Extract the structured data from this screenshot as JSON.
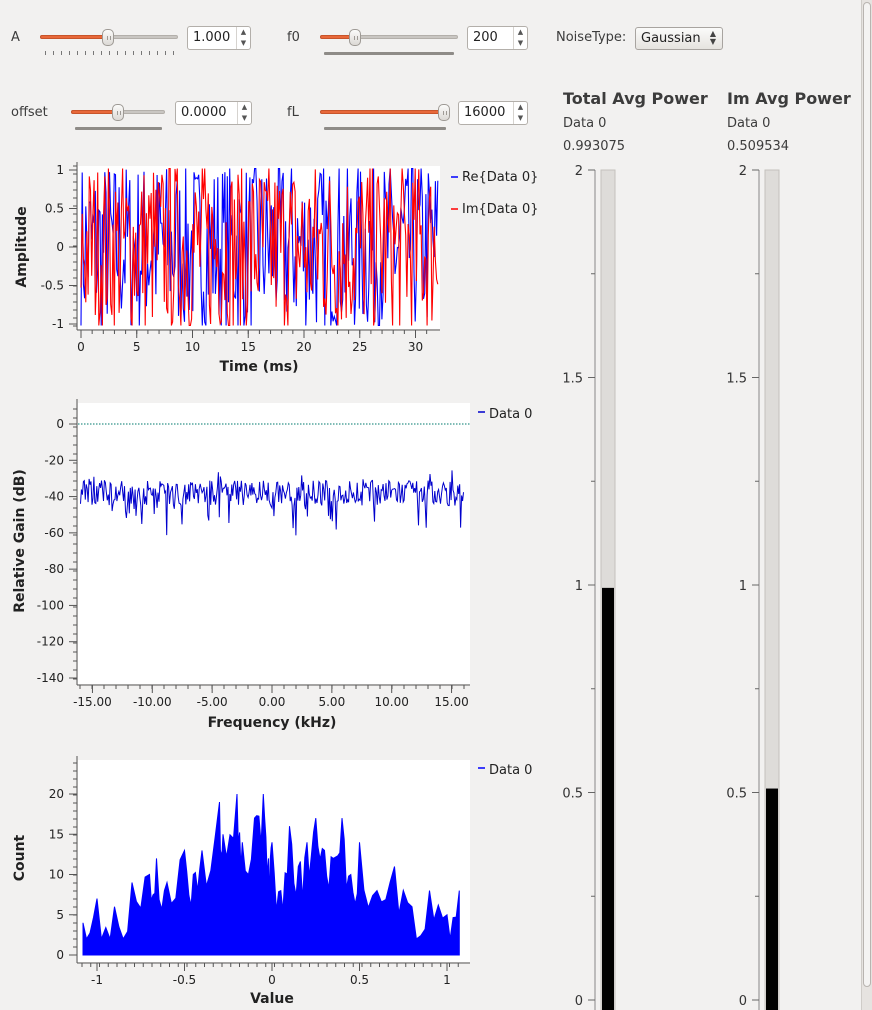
{
  "controls": {
    "a": {
      "label": "A",
      "value": "1.000",
      "fraction": 0.49
    },
    "f0": {
      "label": "f0",
      "value": "200",
      "fraction": 0.23
    },
    "noise_type": {
      "label": "NoiseType:",
      "value": "Gaussian"
    },
    "offset": {
      "label": "offset",
      "value": "0.0000",
      "fraction": 0.5
    },
    "fl": {
      "label": "fL",
      "value": "16000",
      "fraction": 1.0
    }
  },
  "time_plot": {
    "ylabel": "Amplitude",
    "xlabel": "Time (ms)",
    "yticks": [
      "1",
      "0.5",
      "0",
      "-0.5",
      "-1"
    ],
    "xticks": [
      "0",
      "5",
      "10",
      "15",
      "20",
      "25",
      "30"
    ],
    "legend": [
      "Re{Data 0}",
      "Im{Data 0}"
    ],
    "colors": [
      "#0000ff",
      "#ff0000"
    ]
  },
  "freq_plot": {
    "ylabel": "Relative Gain (dB)",
    "xlabel": "Frequency (kHz)",
    "yticks": [
      "0",
      "-20",
      "-40",
      "-60",
      "-80",
      "-100",
      "-120",
      "-140"
    ],
    "xticks": [
      "-15.00",
      "-10.00",
      "-5.00",
      "0.00",
      "5.00",
      "10.00",
      "15.00"
    ],
    "legend": [
      "Data 0"
    ],
    "color": "#0000cc"
  },
  "hist_plot": {
    "ylabel": "Count",
    "xlabel": "Value",
    "yticks": [
      "20",
      "15",
      "10",
      "5",
      "0"
    ],
    "xticks": [
      "-1",
      "-0.5",
      "0",
      "0.5",
      "1"
    ],
    "legend": [
      "Data 0"
    ],
    "color": "#0000ff"
  },
  "total_power": {
    "title": "Total Avg Power",
    "series": "Data 0",
    "value": "0.993075",
    "level": 0.993075,
    "ticks": [
      "2",
      "1.5",
      "1",
      "0.5",
      "0"
    ]
  },
  "im_power": {
    "title": "Im Avg Power",
    "series": "Data 0",
    "value": "0.509534",
    "level": 0.509534,
    "ticks": [
      "2",
      "1.5",
      "1",
      "0.5",
      "0"
    ]
  },
  "chart_data": [
    {
      "type": "line",
      "xlabel": "Time (ms)",
      "ylabel": "Amplitude",
      "xlim": [
        0,
        32
      ],
      "ylim": [
        -1,
        1
      ],
      "series": [
        {
          "name": "Re{Data 0}"
        },
        {
          "name": "Im{Data 0}"
        }
      ]
    },
    {
      "type": "line",
      "xlabel": "Frequency (kHz)",
      "ylabel": "Relative Gain (dB)",
      "xlim": [
        -16,
        16
      ],
      "ylim": [
        -140,
        0
      ],
      "series": [
        {
          "name": "Data 0",
          "mean": -38
        }
      ]
    },
    {
      "type": "area",
      "xlabel": "Value",
      "ylabel": "Count",
      "xlim": [
        -1.1,
        1.1
      ],
      "ylim": [
        0,
        24
      ],
      "series": [
        {
          "name": "Data 0",
          "x": [
            -1.08,
            -1.0,
            -0.9,
            -0.8,
            -0.7,
            -0.66,
            -0.6,
            -0.5,
            -0.45,
            -0.4,
            -0.3,
            -0.28,
            -0.2,
            -0.17,
            -0.1,
            -0.05,
            -0.02,
            0.0,
            0.05,
            0.1,
            0.15,
            0.2,
            0.25,
            0.3,
            0.35,
            0.4,
            0.45,
            0.5,
            0.6,
            0.7,
            0.8,
            0.9,
            1.0,
            1.07
          ],
          "values": [
            4,
            7,
            6,
            9,
            10,
            12,
            9,
            13,
            10,
            13,
            19,
            15,
            20,
            14,
            17,
            20,
            12,
            14,
            8,
            16,
            11,
            14,
            17,
            13,
            12,
            17,
            10,
            14,
            8,
            11,
            6,
            8,
            5,
            8
          ]
        }
      ]
    },
    {
      "type": "bar",
      "title": "Total Avg Power",
      "categories": [
        "Data 0"
      ],
      "values": [
        0.993075
      ],
      "ylim": [
        0,
        2
      ]
    },
    {
      "type": "bar",
      "title": "Im Avg Power",
      "categories": [
        "Data 0"
      ],
      "values": [
        0.509534
      ],
      "ylim": [
        0,
        2
      ]
    }
  ]
}
